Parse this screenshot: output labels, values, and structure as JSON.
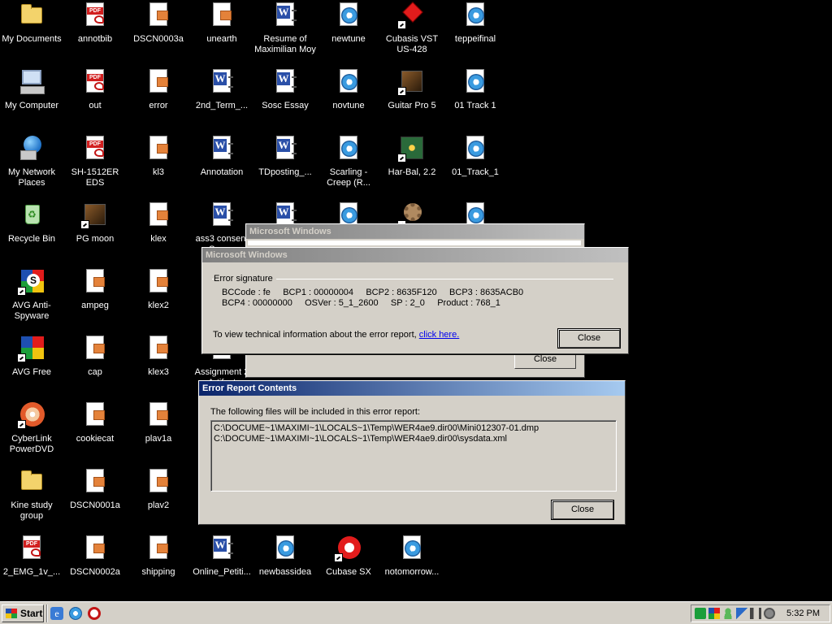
{
  "desktop": {
    "icons": [
      {
        "label": "My Documents",
        "icon": "folder-icon"
      },
      {
        "label": "annotbib",
        "icon": "pdf-file-icon"
      },
      {
        "label": "DSCN0003a",
        "icon": "image-file-icon"
      },
      {
        "label": "unearth",
        "icon": "image-file-icon"
      },
      {
        "label": "Resume of Maximilian Moy",
        "icon": "word-document-icon"
      },
      {
        "label": "newtune",
        "icon": "media-file-icon"
      },
      {
        "label": "Cubasis VST US-428",
        "icon": "cubasis-icon"
      },
      {
        "label": "teppeifinal",
        "icon": "media-file-icon"
      },
      {
        "label": "My Computer",
        "icon": "my-computer-icon"
      },
      {
        "label": "out",
        "icon": "pdf-file-icon"
      },
      {
        "label": "error",
        "icon": "image-file-icon"
      },
      {
        "label": "2nd_Term_...",
        "icon": "word-document-icon"
      },
      {
        "label": "Sosc Essay",
        "icon": "word-document-icon"
      },
      {
        "label": "novtune",
        "icon": "media-file-icon"
      },
      {
        "label": "Guitar Pro 5",
        "icon": "guitar-pro-icon"
      },
      {
        "label": "01 Track 1",
        "icon": "media-file-icon"
      },
      {
        "label": "My Network Places",
        "icon": "network-places-icon"
      },
      {
        "label": "SH-1512ER EDS",
        "icon": "pdf-file-icon"
      },
      {
        "label": "kl3",
        "icon": "image-file-icon"
      },
      {
        "label": "Annotation",
        "icon": "word-document-icon"
      },
      {
        "label": "TDposting_...",
        "icon": "word-document-icon"
      },
      {
        "label": "Scarling - Creep (R...",
        "icon": "media-file-icon"
      },
      {
        "label": "Har-Bal, 2.2",
        "icon": "harbal-icon"
      },
      {
        "label": "01_Track_1",
        "icon": "media-file-icon"
      },
      {
        "label": "Recycle Bin",
        "icon": "recycle-bin-icon"
      },
      {
        "label": "PG moon",
        "icon": "guitar-pro-icon"
      },
      {
        "label": "klex",
        "icon": "image-file-icon"
      },
      {
        "label": "ass3 consent Sum...",
        "icon": "word-document-icon"
      },
      {
        "label": "",
        "icon": "word-document-icon"
      },
      {
        "label": "",
        "icon": "media-file-icon"
      },
      {
        "label": "",
        "icon": "gear-app-icon"
      },
      {
        "label": "",
        "icon": "media-file-icon"
      },
      {
        "label": "AVG Anti-Spyware",
        "icon": "avg-antispyware-icon"
      },
      {
        "label": "ampeg",
        "icon": "image-file-icon"
      },
      {
        "label": "klex2",
        "icon": "image-file-icon"
      },
      {
        "label": "AVG Free",
        "icon": "avg-free-icon"
      },
      {
        "label": "cap",
        "icon": "image-file-icon"
      },
      {
        "label": "klex3",
        "icon": "image-file-icon"
      },
      {
        "label": "Assignment 2 Artifact",
        "icon": "word-document-icon"
      },
      {
        "label": "CyberLink PowerDVD",
        "icon": "powerdvd-icon"
      },
      {
        "label": "cookiecat",
        "icon": "image-file-icon"
      },
      {
        "label": "plav1a",
        "icon": "image-file-icon"
      },
      {
        "label": "Kine study group",
        "icon": "folder-icon"
      },
      {
        "label": "DSCN0001a",
        "icon": "image-file-icon"
      },
      {
        "label": "plav2",
        "icon": "image-file-icon"
      },
      {
        "label": "2_EMG_1v_...",
        "icon": "pdf-file-icon"
      },
      {
        "label": "DSCN0002a",
        "icon": "image-file-icon"
      },
      {
        "label": "shipping",
        "icon": "image-file-icon"
      },
      {
        "label": "Online_Petiti...",
        "icon": "word-document-icon"
      },
      {
        "label": "newbassidea",
        "icon": "media-file-icon"
      },
      {
        "label": "Cubase SX",
        "icon": "cubase-icon"
      },
      {
        "label": "notomorrow...",
        "icon": "media-file-icon"
      }
    ]
  },
  "back_dialog": {
    "title": "Microsoft Windows",
    "close_label": "Close"
  },
  "error_dialog": {
    "title": "Microsoft Windows",
    "group_label": "Error signature",
    "sig_line1": "BCCode : fe     BCP1 : 00000004     BCP2 : 8635F120     BCP3 : 8635ACB0",
    "sig_line2": "BCP4 : 00000000     OSVer : 5_1_2600     SP : 2_0     Product : 768_1",
    "info_text": "To view technical information about the error report, ",
    "link_text": "click here.",
    "close_label": "Close"
  },
  "contents_dialog": {
    "title": "Error Report Contents",
    "intro": "The following files will be included in this error report:",
    "files": [
      "C:\\DOCUME~1\\MAXIMI~1\\LOCALS~1\\Temp\\WER4ae9.dir00\\Mini012307-01.dmp",
      "C:\\DOCUME~1\\MAXIMI~1\\LOCALS~1\\Temp\\WER4ae9.dir00\\sysdata.xml"
    ],
    "close_label": "Close"
  },
  "taskbar": {
    "start_label": "Start",
    "quick_launch": [
      "ie-icon",
      "media-player-icon",
      "antivirus-quicklaunch-icon"
    ],
    "tray_icons": [
      "spyware-tray-icon",
      "avg-tray-icon",
      "messenger-tray-icon",
      "network-tray-icon",
      "volume-tray-icon",
      "update-tray-icon"
    ],
    "clock": "5:32 PM"
  },
  "colors": {
    "desktop": "#000000",
    "face": "#d4d0c8",
    "active_title": "#0a246a",
    "inactive_title": "#808080",
    "link": "#0000ee"
  }
}
